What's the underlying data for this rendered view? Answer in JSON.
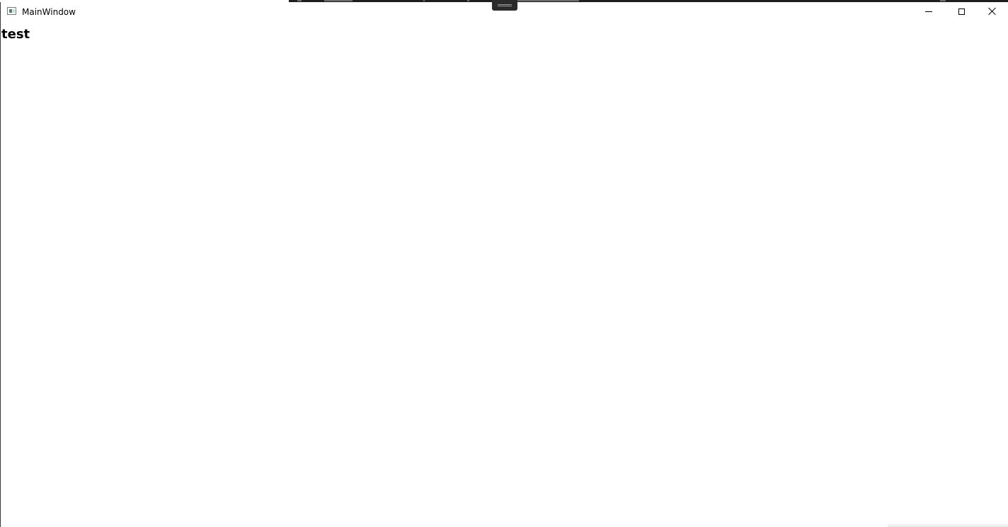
{
  "window": {
    "title": "MainWindow"
  },
  "caption_buttons": {
    "minimize": "minimize",
    "maximize": "maximize",
    "close": "close"
  },
  "content": {
    "heading": "test"
  },
  "colors": {
    "background": "#ffffff",
    "text": "#000000",
    "close_hover": "#e81123",
    "behind_desktop": "#1e1e1e"
  }
}
